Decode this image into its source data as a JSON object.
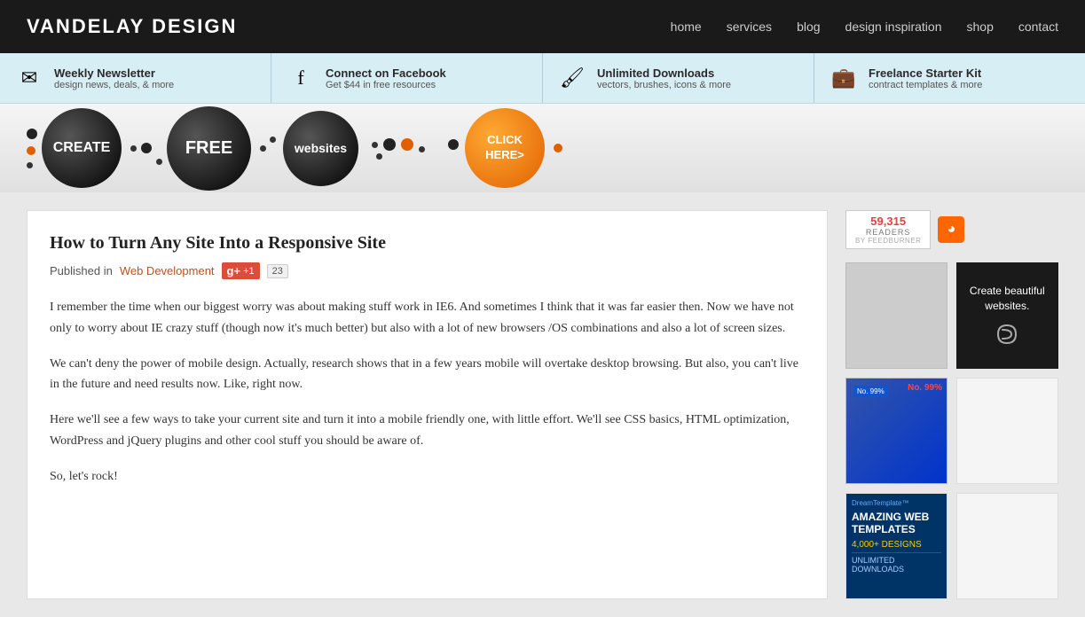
{
  "header": {
    "logo": "VANDELAY DESIGN",
    "nav": [
      {
        "label": "home",
        "id": "home"
      },
      {
        "label": "services",
        "id": "services"
      },
      {
        "label": "blog",
        "id": "blog"
      },
      {
        "label": "design inspiration",
        "id": "design-inspiration"
      },
      {
        "label": "shop",
        "id": "shop"
      },
      {
        "label": "contact",
        "id": "contact"
      }
    ]
  },
  "promo_bar": {
    "items": [
      {
        "id": "weekly-newsletter",
        "icon": "✉",
        "title": "Weekly Newsletter",
        "sub": "design news, deals, & more"
      },
      {
        "id": "facebook",
        "icon": "f",
        "title": "Connect on Facebook",
        "sub": "Get $44 in free resources"
      },
      {
        "id": "downloads",
        "icon": "🖌",
        "title": "Unlimited Downloads",
        "sub": "vectors, brushes, icons & more"
      },
      {
        "id": "freelance",
        "icon": "💼",
        "title": "Freelance Starter Kit",
        "sub": "contract templates & more"
      }
    ]
  },
  "banner": {
    "create_label": "CREATE",
    "free_label": "FREE",
    "websites_label": "websites",
    "click_label": "CLICK\nHERE>"
  },
  "feedburner": {
    "count": "59,315",
    "readers_label": "readers",
    "by_label": "BY FEEDBURNER"
  },
  "article": {
    "title": "How to Turn Any Site Into a Responsive Site",
    "meta_published": "Published in",
    "category": "Web Development",
    "share_count": "23",
    "body": [
      "I remember the time when our biggest worry was about making stuff work in IE6. And sometimes I think that it was far easier then. Now we have not only to worry about IE crazy stuff (though now it's much better) but also with a lot of new browsers /OS combinations and also a lot of screen sizes.",
      "We can't deny the power of mobile design. Actually, research shows that in a few years mobile will overtake desktop browsing. But also, you can't live in the future and need results now. Like, right now.",
      "Here we'll see a few ways to take your current site and turn it into a mobile friendly one, with little effort. We'll see CSS basics, HTML optimization, WordPress and jQuery plugins and other cool stuff you should be aware of.",
      "So, let's rock!"
    ]
  },
  "sidebar": {
    "squarespace": {
      "text": "Create beautiful websites.",
      "logo_symbol": "S"
    },
    "dreamtemplate": {
      "brand": "DreamTemplate™",
      "title": "AMAZING WEB TEMPLATES",
      "subtitle": "4,000+ DESIGNS",
      "desc": "UNLIMITED DOWNLOADS"
    }
  }
}
